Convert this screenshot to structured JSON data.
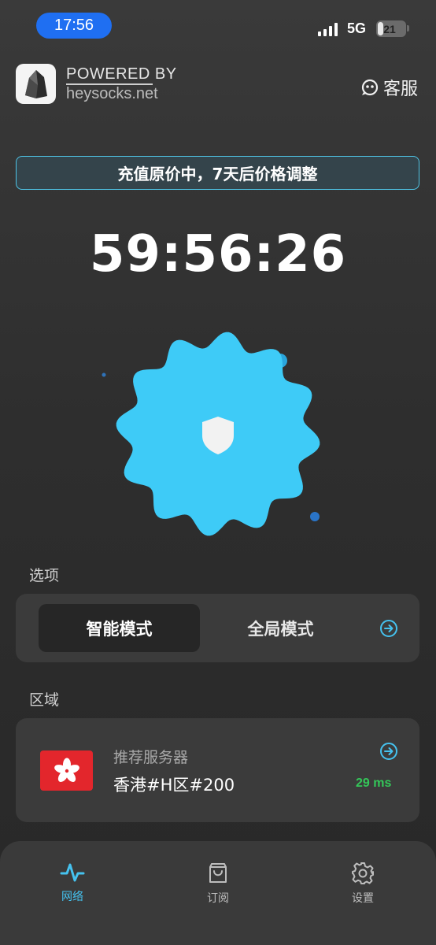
{
  "status_bar": {
    "time": "17:56",
    "network": "5G",
    "battery": "21",
    "battery_level": 0.21
  },
  "header": {
    "powered_by": "POWERED BY",
    "domain": "heysocks.net",
    "support_label": "客服"
  },
  "banner": {
    "text": "充值原价中，7天后价格调整"
  },
  "countdown": "59:56:26",
  "options": {
    "section_label": "选项",
    "modes": [
      {
        "label": "智能模式",
        "selected": true
      },
      {
        "label": "全局模式",
        "selected": false
      }
    ]
  },
  "region": {
    "section_label": "区域",
    "subtitle": "推荐服务器",
    "server_name": "香港#H区#200",
    "latency": "29 ms"
  },
  "tabbar": {
    "tabs": [
      {
        "label": "网络",
        "icon": "activity-icon",
        "active": true
      },
      {
        "label": "订阅",
        "icon": "shopping-bag-icon",
        "active": false
      },
      {
        "label": "设置",
        "icon": "gear-icon",
        "active": false
      }
    ]
  },
  "colors": {
    "accent": "#45c2ef",
    "blob": "#3ecbf7",
    "time_pill": "#1f6ff2",
    "latency_green": "#34c759",
    "flag_red": "#e3262c"
  }
}
